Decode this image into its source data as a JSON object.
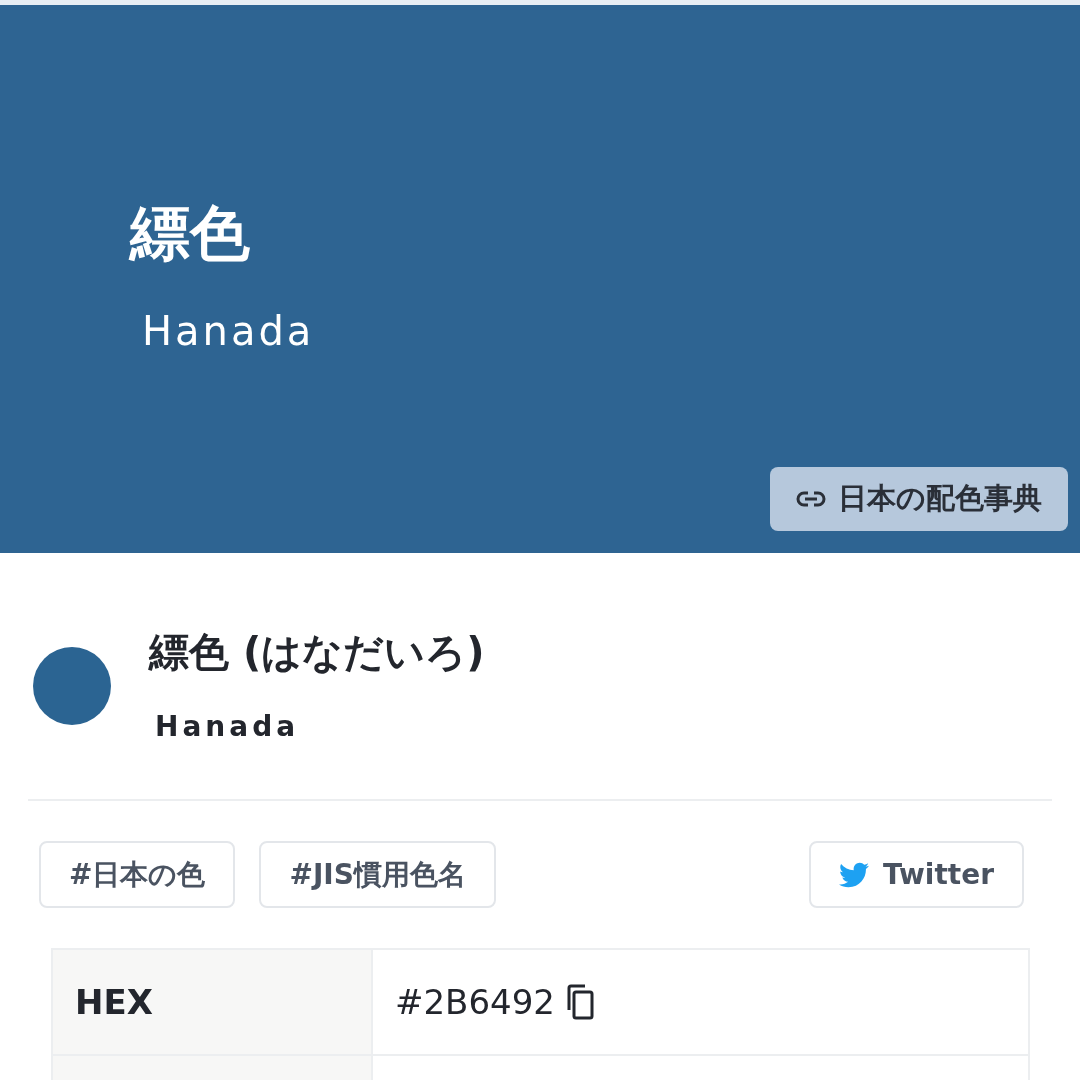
{
  "hero": {
    "title": "縹色",
    "romaji": "Hanada",
    "link_button": "日本の配色事典"
  },
  "heading": {
    "name": "縹色 (はなだいろ)",
    "romaji": "Hanada"
  },
  "tags": [
    "#日本の色",
    "#JIS慣用色名"
  ],
  "share_button": "Twitter",
  "table": {
    "rows": [
      {
        "label": "HEX",
        "value": "#2B6492"
      }
    ]
  }
}
